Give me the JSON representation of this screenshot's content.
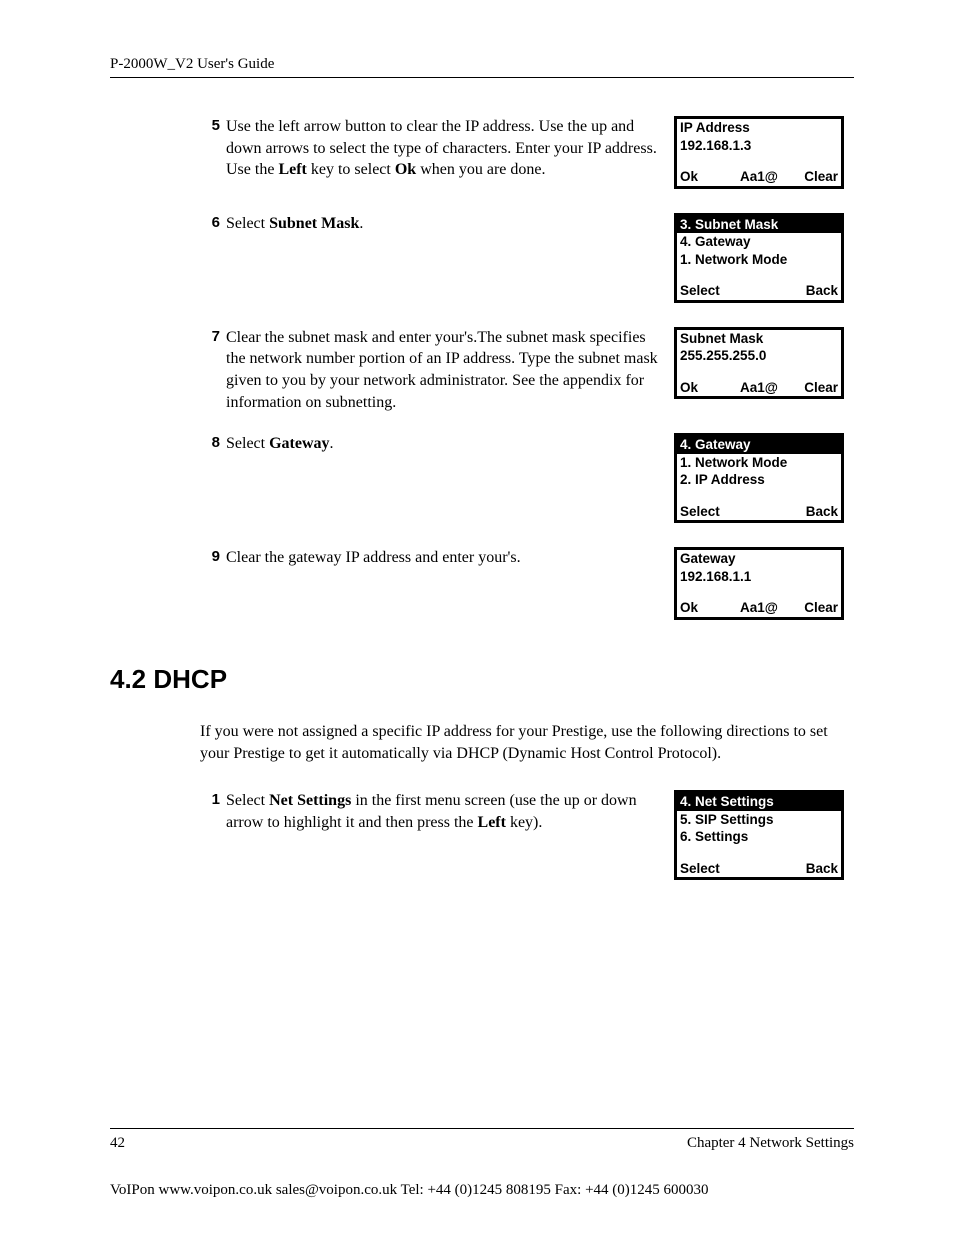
{
  "header": {
    "title": "P-2000W_V2 User's Guide"
  },
  "steps_a": [
    {
      "num": "5",
      "text_parts": [
        "Use the left arrow button to clear the IP address. Use the up and down arrows to select the type of characters. Enter your IP address. Use the ",
        "Left",
        " key to select ",
        "Ok",
        " when you are done."
      ],
      "bold_idx": [
        1,
        3
      ],
      "screen": {
        "lines": [
          {
            "text": "IP Address",
            "hl": false
          },
          {
            "text": "192.168.1.3",
            "hl": false
          }
        ],
        "softkeys": {
          "left": "Ok",
          "center": "Aa1@",
          "right": "Clear"
        }
      }
    },
    {
      "num": "6",
      "text_parts": [
        "Select ",
        "Subnet Mask",
        "."
      ],
      "bold_idx": [
        1
      ],
      "screen": {
        "lines": [
          {
            "text": "3. Subnet Mask",
            "hl": true
          },
          {
            "text": "4. Gateway",
            "hl": false
          },
          {
            "text": "1. Network Mode",
            "hl": false
          }
        ],
        "softkeys": {
          "left": "Select",
          "center": "",
          "right": "Back"
        }
      }
    },
    {
      "num": "7",
      "text_parts": [
        "Clear the subnet mask and enter your's.The subnet mask specifies the network number portion of an IP address. Type the subnet mask given to you by your network administrator. See the appendix for information on subnetting."
      ],
      "bold_idx": [],
      "screen": {
        "lines": [
          {
            "text": "Subnet Mask",
            "hl": false
          },
          {
            "text": "255.255.255.0",
            "hl": false
          }
        ],
        "softkeys": {
          "left": "Ok",
          "center": "Aa1@",
          "right": "Clear"
        }
      }
    },
    {
      "num": "8",
      "text_parts": [
        "Select ",
        "Gateway",
        "."
      ],
      "bold_idx": [
        1
      ],
      "screen": {
        "lines": [
          {
            "text": "4. Gateway",
            "hl": true
          },
          {
            "text": "1. Network Mode",
            "hl": false
          },
          {
            "text": "2. IP Address",
            "hl": false
          }
        ],
        "softkeys": {
          "left": "Select",
          "center": "",
          "right": "Back"
        }
      }
    },
    {
      "num": "9",
      "text_parts": [
        "Clear the gateway IP address and enter your's."
      ],
      "bold_idx": [],
      "screen": {
        "lines": [
          {
            "text": "Gateway",
            "hl": false
          },
          {
            "text": "192.168.1.1",
            "hl": false
          }
        ],
        "softkeys": {
          "left": "Ok",
          "center": "Aa1@",
          "right": "Clear"
        }
      }
    }
  ],
  "section_heading": "4.2  DHCP",
  "section_intro": "If you were not assigned a specific IP address for your Prestige, use the following directions to set your Prestige to get it automatically via DHCP (Dynamic Host Control Protocol).",
  "steps_b": [
    {
      "num": "1",
      "text_parts": [
        "Select ",
        "Net Settings",
        " in the first menu screen (use the up or down arrow to highlight it and then press the ",
        "Left",
        " key)."
      ],
      "bold_idx": [
        1,
        3
      ],
      "screen": {
        "lines": [
          {
            "text": "4. Net Settings",
            "hl": true
          },
          {
            "text": "5. SIP Settings",
            "hl": false
          },
          {
            "text": "6. Settings",
            "hl": false
          }
        ],
        "softkeys": {
          "left": "Select",
          "center": "",
          "right": "Back"
        }
      }
    }
  ],
  "footer": {
    "page_num": "42",
    "chapter": "Chapter 4 Network Settings",
    "bottom": "VoIPon    www.voipon.co.uk    sales@voipon.co.uk    Tel: +44 (0)1245 808195    Fax: +44 (0)1245 600030"
  }
}
